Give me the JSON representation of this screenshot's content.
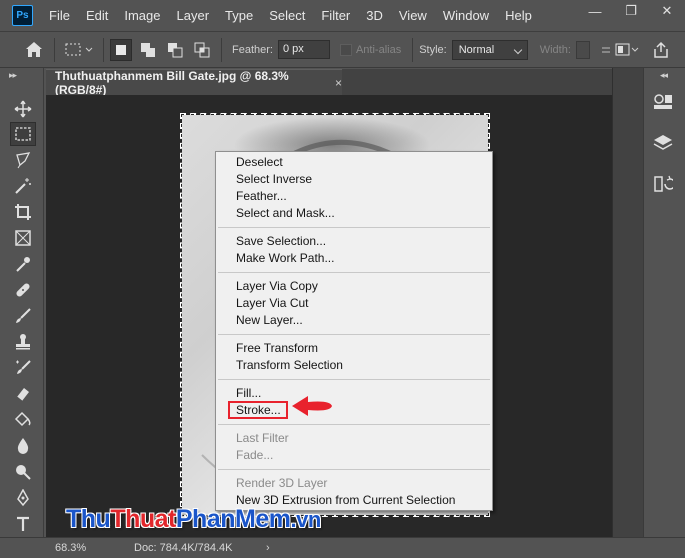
{
  "app": {
    "logo_text": "Ps",
    "menu": [
      "File",
      "Edit",
      "Image",
      "Layer",
      "Type",
      "Select",
      "Filter",
      "3D",
      "View",
      "Window",
      "Help"
    ],
    "window_controls": {
      "minimize": "—",
      "restore": "❐",
      "close": "✕"
    }
  },
  "options_bar": {
    "feather_label": "Feather:",
    "feather_value": "0 px",
    "antialias_label": "Anti-alias",
    "style_label": "Style:",
    "style_value": "Normal",
    "width_label": "Width:"
  },
  "document": {
    "tab_title": "Thuthuatphanmem Bill Gate.jpg @ 68.3% (RGB/8#)",
    "tab_close": "×"
  },
  "context_menu": {
    "groups": [
      [
        "Deselect",
        "Select Inverse",
        "Feather...",
        "Select and Mask..."
      ],
      [
        "Save Selection...",
        "Make Work Path..."
      ],
      [
        "Layer Via Copy",
        "Layer Via Cut",
        "New Layer..."
      ],
      [
        "Free Transform",
        "Transform Selection"
      ],
      [
        "Fill...",
        "Stroke..."
      ],
      [
        "Last Filter",
        "Fade..."
      ],
      [
        "Render 3D Layer",
        "New 3D Extrusion from Current Selection"
      ]
    ],
    "highlighted_item": "Stroke..."
  },
  "watermark": {
    "part1": "Thu",
    "part2": "Thuat",
    "part3": "PhanMem",
    "part4": ".vn"
  },
  "status_bar": {
    "zoom": "68.3%",
    "doc_size": "Doc: 784.4K/784.4K",
    "arrow": "›"
  },
  "colors": {
    "accent_annotation": "#e8222d",
    "ps_brand": "#31a8ff",
    "watermark_blue": "#1a55c9",
    "watermark_red": "#e2262b"
  },
  "icons": {
    "toolbar": [
      "move-icon",
      "marquee-icon",
      "lasso-icon",
      "magic-wand-icon",
      "crop-icon",
      "frame-icon",
      "eyedropper-icon",
      "healing-icon",
      "brush-icon",
      "stamp-icon",
      "history-brush-icon",
      "eraser-icon",
      "paint-bucket-icon",
      "blur-icon",
      "dodge-icon",
      "pen-icon",
      "type-icon",
      "path-select-icon"
    ],
    "right_panel": [
      "learn-icon",
      "layers-icon",
      "history-icon"
    ]
  }
}
